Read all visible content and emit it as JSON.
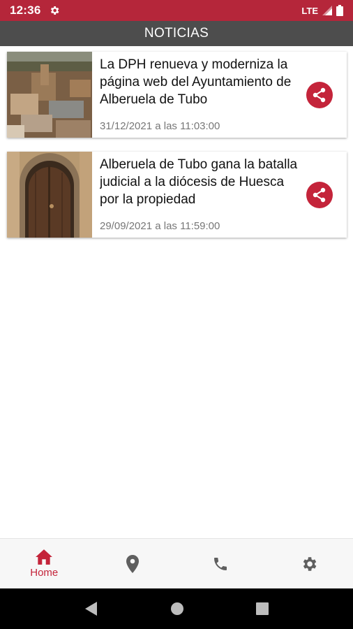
{
  "status_bar": {
    "time": "12:36",
    "network": "LTE",
    "gear_icon": "settings-icon",
    "signal_icon": "signal-icon",
    "battery_icon": "battery-icon"
  },
  "app_bar": {
    "title": "NOTICIAS"
  },
  "news": [
    {
      "title": "La DPH renueva y moderniza la página web del Ayuntamiento de Alberuela de Tubo",
      "date": "31/12/2021 a las 11:03:00",
      "image": "aerial-village-photo",
      "share_icon": "share-icon"
    },
    {
      "title": "Alberuela de Tubo gana la batalla judicial a la diócesis de Huesca por la propiedad",
      "date": "29/09/2021 a las 11:59:00",
      "image": "wooden-arched-door-photo",
      "share_icon": "share-icon"
    }
  ],
  "bottom_nav": {
    "items": [
      {
        "label": "Home",
        "icon": "home-icon",
        "active": true
      },
      {
        "label": "",
        "icon": "location-pin-icon",
        "active": false
      },
      {
        "label": "",
        "icon": "phone-icon",
        "active": false
      },
      {
        "label": "",
        "icon": "settings-icon",
        "active": false
      }
    ]
  },
  "system_nav": {
    "back_icon": "back-icon",
    "home_icon": "home-circle-icon",
    "recents_icon": "recents-icon"
  },
  "colors": {
    "accent": "#c4243a",
    "status_bar": "#b5263a",
    "app_bar": "#4d4d4d",
    "inactive_icon": "#5f5f5f"
  }
}
